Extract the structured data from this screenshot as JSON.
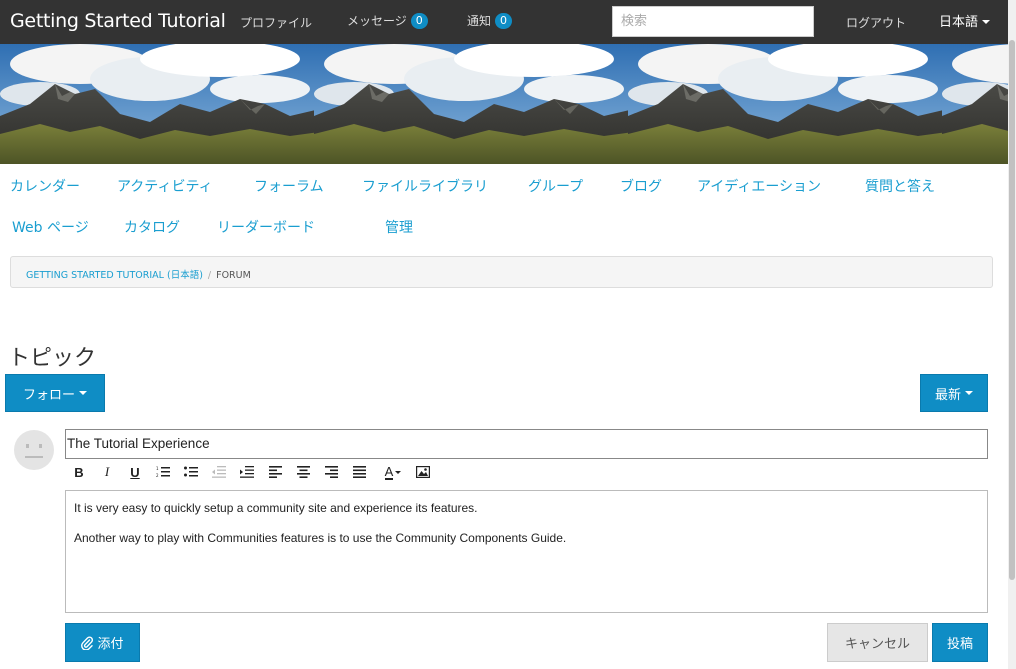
{
  "topbar": {
    "brand": "Getting Started Tutorial",
    "profile": "プロファイル",
    "messages": "メッセージ",
    "messages_count": "0",
    "notifications": "通知",
    "notifications_count": "0",
    "search_placeholder": "検索",
    "logout": "ログアウト",
    "language": "日本語"
  },
  "community_nav": [
    "カレンダー",
    "アクティビティ",
    "フォーラム",
    "ファイルライブラリ",
    "グループ",
    "ブログ",
    "アイディエーション",
    "質問と答え",
    "Web ページ",
    "カタログ",
    "リーダーボード",
    "管理"
  ],
  "breadcrumb": {
    "parent": "GETTING STARTED TUTORIAL (日本語)",
    "separator": "/",
    "current": "FORUM"
  },
  "page_title": "トピック",
  "follow_button": "フォロー",
  "sort_button": "最新",
  "composer": {
    "subject_value": "The Tutorial Experience",
    "body_lines": [
      "It is very easy to quickly setup a community site and experience its features.",
      "Another way to play with Communities features is to use the Community Components Guide."
    ],
    "toolbar": {
      "bold": "B",
      "italic": "I",
      "underline": "U",
      "font_color": "A"
    },
    "attach_button": "添付",
    "cancel_button": "キャンセル",
    "post_button": "投稿"
  },
  "colors": {
    "topbar": "#333333",
    "link": "#1a9ed0",
    "primary_button": "#0f8dc5"
  }
}
